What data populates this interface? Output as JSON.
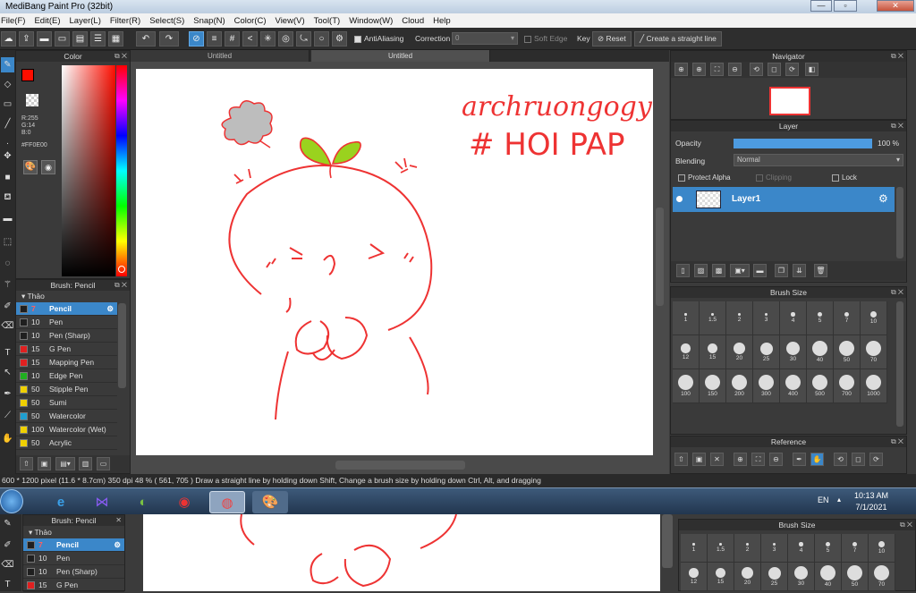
{
  "window": {
    "title": "MediBang Paint Pro (32bit)",
    "min": "—",
    "max": "▫",
    "close": "✕"
  },
  "menu": [
    "File(F)",
    "Edit(E)",
    "Layer(L)",
    "Filter(R)",
    "Select(S)",
    "Snap(N)",
    "Color(C)",
    "View(V)",
    "Tool(T)",
    "Window(W)",
    "Cloud",
    "Help"
  ],
  "toolbar": {
    "antialiasing": "AntiAliasing",
    "correction_label": "Correction",
    "correction_value": "0",
    "soft_edge": "Soft Edge",
    "key_label": "Key",
    "reset": "Reset",
    "straight_line": "Create a straight line"
  },
  "tabs": [
    "Untitled",
    "Untitled"
  ],
  "color_panel": {
    "title": "Color",
    "r": "R:255",
    "g": "G:14",
    "b": "B:0",
    "hex": "#FF0E00",
    "main_color": "#ff0e00"
  },
  "brush_panel": {
    "title": "Brush: Pencil",
    "group": "Thảo",
    "items": [
      {
        "size": "7",
        "name": "Pencil",
        "color": "#1f1f1f"
      },
      {
        "size": "10",
        "name": "Pen",
        "color": "#1f1f1f"
      },
      {
        "size": "10",
        "name": "Pen (Sharp)",
        "color": "#1f1f1f"
      },
      {
        "size": "15",
        "name": "G Pen",
        "color": "#e02020"
      },
      {
        "size": "15",
        "name": "Mapping Pen",
        "color": "#e02020"
      },
      {
        "size": "10",
        "name": "Edge Pen",
        "color": "#20b020"
      },
      {
        "size": "50",
        "name": "Stipple Pen",
        "color": "#f0d000"
      },
      {
        "size": "50",
        "name": "Sumi",
        "color": "#f0d000"
      },
      {
        "size": "50",
        "name": "Watercolor",
        "color": "#1f9fd0"
      },
      {
        "size": "100",
        "name": "Watercolor (Wet)",
        "color": "#f0d000"
      },
      {
        "size": "50",
        "name": "Acrylic",
        "color": "#f0d000"
      }
    ],
    "selected": 0
  },
  "navigator": {
    "title": "Navigator"
  },
  "layer_panel": {
    "title": "Layer",
    "opacity_label": "Opacity",
    "opacity_value": "100 %",
    "opacity_percent": 100,
    "blending_label": "Blending",
    "blending_value": "Normal",
    "protect_alpha": "Protect Alpha",
    "clipping": "Clipping",
    "lock": "Lock",
    "layer_name": "Layer1"
  },
  "brush_size": {
    "title": "Brush Size",
    "rows": [
      [
        "1",
        "1.5",
        "2",
        "3",
        "4",
        "5",
        "7",
        "10"
      ],
      [
        "12",
        "15",
        "20",
        "25",
        "30",
        "40",
        "50",
        "70"
      ],
      [
        "100",
        "150",
        "200",
        "300",
        "400",
        "500",
        "700",
        "1000"
      ]
    ]
  },
  "reference": {
    "title": "Reference"
  },
  "canvas_text": {
    "line1": "archruongogy",
    "line2": "# HOI PAP"
  },
  "status": {
    "size": "600 * 1200 pixel",
    "cm": "(11.6 * 8.7cm)",
    "dpi": "350 dpi",
    "zoom": "48 %",
    "coords": "( 561, 705 )",
    "hint": "Draw a straight line by holding down Shift, Change a brush size by holding down Ctrl, Alt, and dragging"
  },
  "taskbar": {
    "lang": "EN",
    "time": "10:13 AM",
    "date": "7/1/2021"
  }
}
